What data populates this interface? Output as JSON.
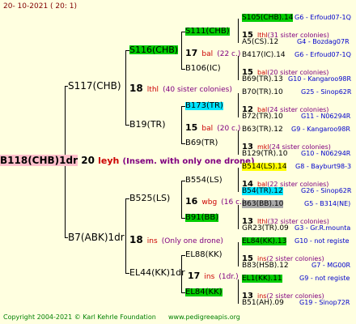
{
  "header": {
    "date": "20-  10-2021  ( 20:  1)"
  },
  "root": {
    "name": "B118(CHB)1dr",
    "num": "20",
    "breeder": "leyh",
    "note": "(Insem. with only one drone)"
  },
  "gen1": {
    "top": {
      "name": "S117(CHB)",
      "num": "18",
      "breeder": "lthl",
      "note": "(40 sister colonies)"
    },
    "bottom": {
      "name": "B7(ABK)1dr",
      "num": "18",
      "breeder": "ins",
      "note": "(Only one drone)"
    }
  },
  "gen2": {
    "s116": {
      "name": "S116(CHB)",
      "num": "17",
      "breeder": "bal",
      "note": "(22 c.)"
    },
    "b19": {
      "name": "B19(TR)",
      "num": "15",
      "breeder": "bal",
      "note": "(20 c.)"
    },
    "b525": {
      "name": "B525(LS)",
      "num": "16",
      "breeder": "wbg",
      "note": "(16 c.)"
    },
    "el44": {
      "name": "EL44(KK)1dr",
      "num": "17",
      "breeder": "ins",
      "note": "(1dr.)"
    }
  },
  "gen3": {
    "s111": {
      "name": "S111(CHB)"
    },
    "b106": {
      "name": "B106(IC)"
    },
    "b173": {
      "name": "B173(TR)"
    },
    "b69": {
      "name": "B69(TR)"
    },
    "b554": {
      "name": "B554(LS)"
    },
    "b91": {
      "name": "B91(BB)"
    },
    "el88": {
      "name": "EL88(KK)"
    },
    "el84": {
      "name": "EL84(KK)"
    }
  },
  "gen4": [
    {
      "name": "S105(CHB).14",
      "right": "G6 - Erfoud07-1Q"
    },
    {
      "num": "15",
      "breeder": "lthl",
      "note": "(31 sister colonies)"
    },
    {
      "name": "A5(CS).12",
      "right": "G4 - Bozdag07R"
    },
    {
      "name": "B417(IC).14",
      "right": "G6 - Erfoud07-1Q"
    },
    {
      "num": "15",
      "breeder": "bal",
      "note": "(20 sister colonies)"
    },
    {
      "name": "B69(TR).13",
      "right": "G10 - Kangaroo98R"
    },
    {
      "name": "B70(TR).10",
      "right": "G25 - Sinop62R"
    },
    {
      "num": "12",
      "breeder": "bal",
      "note": "(24 sister colonies)"
    },
    {
      "name": "B72(TR).10",
      "right": "G11 - N06294R"
    },
    {
      "name": "B63(TR).12",
      "right": "G9 - Kangaroo98R"
    },
    {
      "num": "13",
      "breeder": "mkl",
      "note": "(24 sister colonies)"
    },
    {
      "name": "B129(TR).10",
      "right": "G10 - N06294R"
    },
    {
      "name": "B514(LS).14",
      "right": "G8 - Bayburt98-3"
    },
    {
      "num": "14",
      "breeder": "bal",
      "note": "(22 sister colonies)"
    },
    {
      "name": "B54(TR).12",
      "right": "G26 - Sinop62R"
    },
    {
      "name": "B63(BB).10",
      "right": "G5 - B314(NE)"
    },
    {
      "num": "13",
      "breeder": "lthl",
      "note": "(32 sister colonies)"
    },
    {
      "name": "GR23(TR).09",
      "right": "G3 - Gr.R.mounta"
    },
    {
      "name": "EL84(KK).13",
      "right": "G10 - not registe"
    },
    {
      "num": "15",
      "breeder": "ins",
      "note": "(2 sister colonies)"
    },
    {
      "name": "B83(HSB).12",
      "right": "G7 - MG00R"
    },
    {
      "name": "EL1(KK).11",
      "right": "G9 - not registe"
    },
    {
      "num": "13",
      "breeder": "ins",
      "note": "(2 sister colonies)"
    },
    {
      "name": "B51(AH).09",
      "right": "G19 - Sinop72R"
    }
  ],
  "footer": {
    "copyright": "Copyright 2004-2021 © Karl Kehrle Foundation",
    "site": "www.pedigreeapis.org"
  },
  "colors": {
    "background": "#ffffe0",
    "green": "#00cc00",
    "cyan": "#00e5ff",
    "yellow": "#ffff00",
    "gray": "#a9a9a9"
  }
}
